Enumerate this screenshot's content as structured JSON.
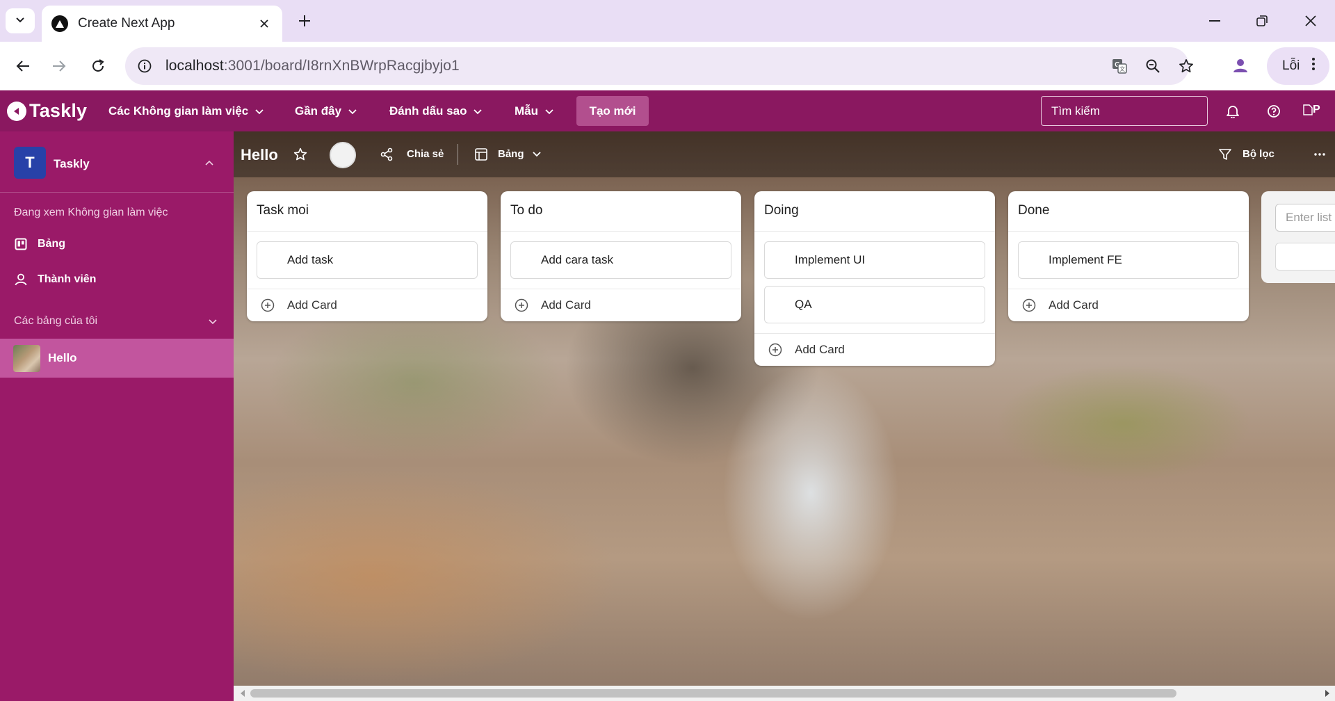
{
  "browser": {
    "tab_title": "Create Next App",
    "url_host": "localhost",
    "url_path": ":3001/board/I8rnXnBWrpRacgjbyjo1",
    "error_chip": "Lỗi"
  },
  "app": {
    "logo": "Taskly",
    "menu": [
      "Các Không gian làm việc",
      "Gần đây",
      "Đánh dấu sao",
      "Mẫu"
    ],
    "create_label": "Tạo mới",
    "search_placeholder": "Tìm kiếm",
    "avatar_alt": "P"
  },
  "sidebar": {
    "workspace_initial": "T",
    "workspace_name": "Taskly",
    "viewing_label": "Đang xem Không gian làm việc",
    "items": [
      "Bảng",
      "Thành viên"
    ],
    "my_boards_label": "Các bảng của tôi",
    "boards": [
      "Hello"
    ]
  },
  "board": {
    "title": "Hello",
    "share_label": "Chia sẻ",
    "view_label": "Bảng",
    "filter_label": "Bộ lọc",
    "new_list_placeholder": "Enter list",
    "add_card_label": "Add Card",
    "lists": [
      {
        "title": "Task moi",
        "cards": [
          "Add task"
        ]
      },
      {
        "title": "To do",
        "cards": [
          "Add cara task"
        ]
      },
      {
        "title": "Doing",
        "cards": [
          "Implement UI",
          "QA"
        ]
      },
      {
        "title": "Done",
        "cards": [
          "Implement FE"
        ]
      }
    ]
  },
  "colors": {
    "brand": "#8a1860",
    "sidebar": "#9a1a68",
    "selected_board": "#c2559e",
    "create_button": "#b24f8e",
    "workspace_avatar": "#2741a8"
  }
}
